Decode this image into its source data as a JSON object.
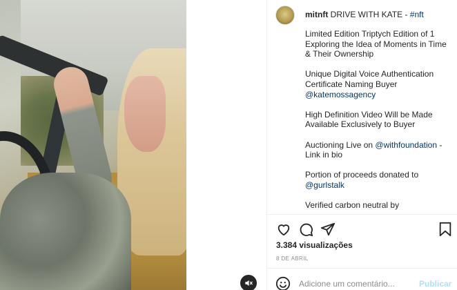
{
  "post": {
    "username": "mitnft",
    "title": "DRIVE WITH KATE -",
    "hashtag": "#nft"
  },
  "caption": {
    "para1": "Limited Edition Triptych Edition of 1 Exploring the Idea of Moments in Time & Their Ownership",
    "para2_text": "Unique Digital Voice Authentication Certificate Naming Buyer",
    "para2_mention": "@katemossagency",
    "para3": "High Definition Video Will be Made Available Exclusively to Buyer",
    "para4_prefix": "Auctioning Live on",
    "para4_mention": "@withfoundation",
    "para4_suffix": "- Link in bio",
    "para5_text": "Portion of proceeds donated to",
    "para5_mention": "@gurlstalk",
    "para6": "Verified carbon neutral by"
  },
  "icons": {
    "like": "heart-icon",
    "comment": "comment-icon",
    "share": "share-icon",
    "save": "bookmark-icon",
    "mute": "volume-muted-icon",
    "emoji": "emoji-icon"
  },
  "stats": {
    "views": "3.384 visualizações",
    "date": "8 DE ABRIL"
  },
  "comment": {
    "placeholder": "Adicione um comentário...",
    "publish_label": "Publicar"
  },
  "colors": {
    "link": "#00376b",
    "publish_disabled": "#b2dffc",
    "muted_text": "#8e8e8e"
  }
}
